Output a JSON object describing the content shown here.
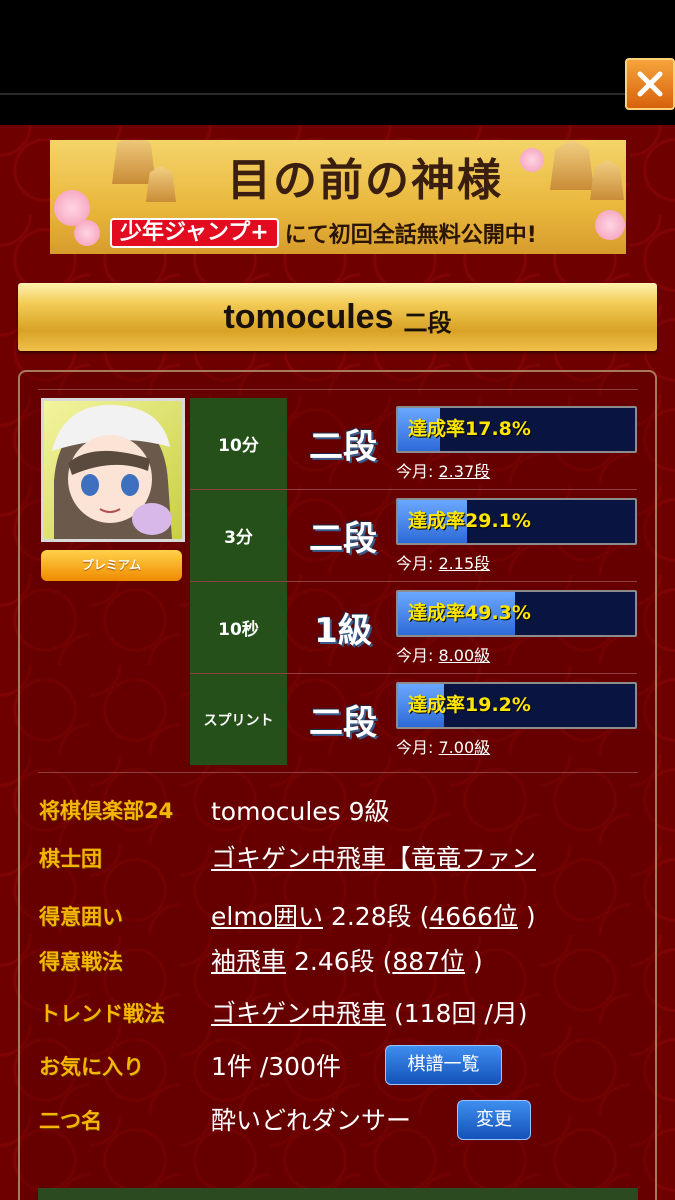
{
  "banner": {
    "title": "目の前の神様",
    "brand": "少年ジャンプ+",
    "tagline": "にて初回全話無料公開中!"
  },
  "player": {
    "name": "tomocules",
    "rank": "二段",
    "badge": "プレミアム"
  },
  "ranks": [
    {
      "mode": "10分",
      "rank": "二段",
      "achievement_label": "達成率17.8%",
      "achievement": 17.8,
      "monthly_label": "今月:",
      "monthly_value": "2.37段"
    },
    {
      "mode": "3分",
      "rank": "二段",
      "achievement_label": "達成率29.1%",
      "achievement": 29.1,
      "monthly_label": "今月:",
      "monthly_value": "2.15段"
    },
    {
      "mode": "10秒",
      "rank": "1級",
      "achievement_label": "達成率49.3%",
      "achievement": 49.3,
      "monthly_label": "今月:",
      "monthly_value": "8.00級"
    },
    {
      "mode": "スプリント",
      "rank": "二段",
      "achievement_label": "達成率19.2%",
      "achievement": 19.2,
      "monthly_label": "今月:",
      "monthly_value": "7.00級"
    }
  ],
  "info": {
    "club24_label": "将棋倶楽部24",
    "club24_value": "tomocules 9級",
    "team_label": "棋士団",
    "team_value": "ゴキゲン中飛車【竜竜ファン",
    "castle_label": "得意囲い",
    "castle_name": "elmo囲い",
    "castle_rank": "2.28段",
    "castle_pos_open": "(",
    "castle_pos": "4666位",
    "castle_pos_close": ")",
    "strategy_label": "得意戦法",
    "strategy_name": "袖飛車",
    "strategy_rank": "2.46段",
    "strategy_pos_open": "(",
    "strategy_pos": "887位",
    "strategy_pos_close": ")",
    "trend_label": "トレンド戦法",
    "trend_name": "ゴキゲン中飛車",
    "trend_count": "(118回 /月)",
    "fav_label": "お気に入り",
    "fav_value": "1件 /300件",
    "fav_button": "棋譜一覧",
    "nickname_label": "二つ名",
    "nickname_value": "酔いどれダンサー",
    "nickname_button": "変更"
  },
  "icons": {
    "close": "close-icon"
  },
  "colors": {
    "label": "#f7b400",
    "background": "#6e0000",
    "progress": "#2e6ad8"
  }
}
